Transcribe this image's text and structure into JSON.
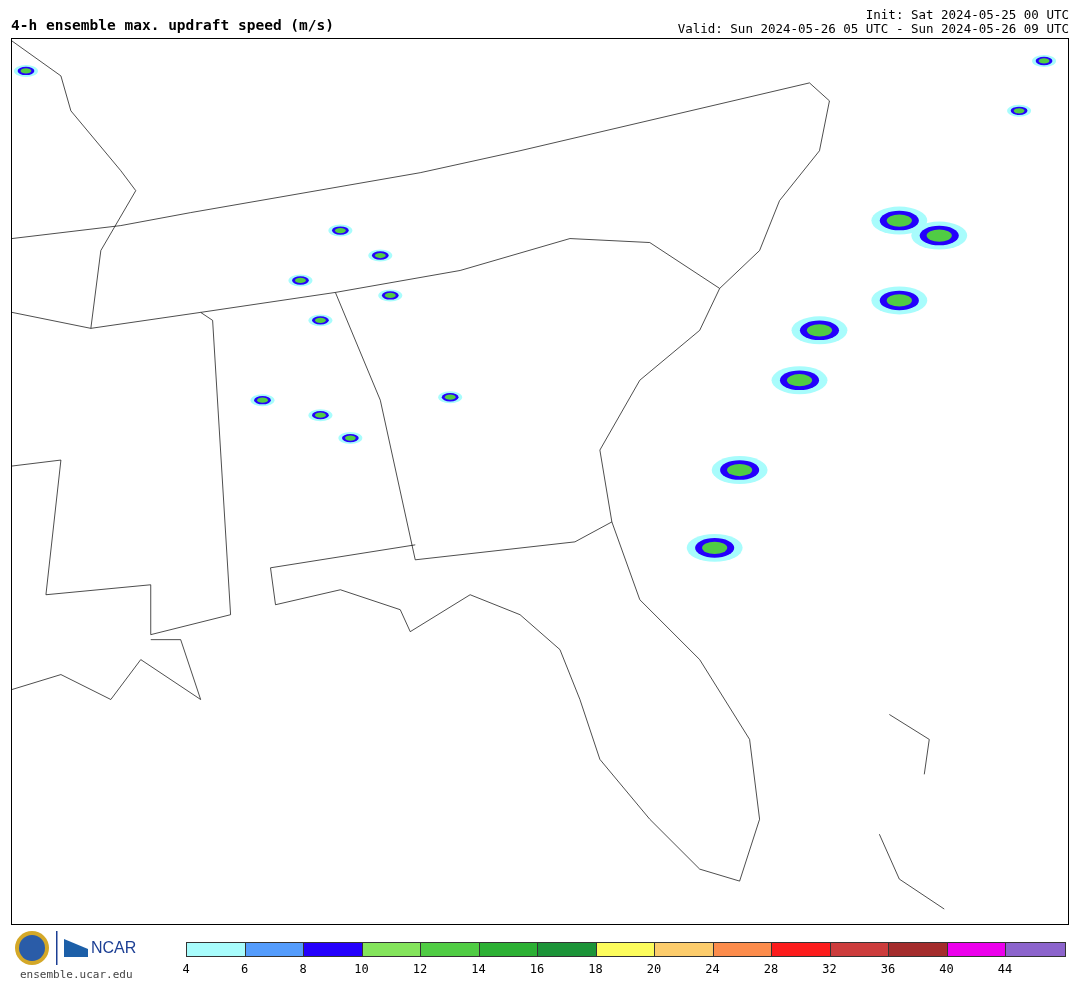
{
  "title": "4-h ensemble max. updraft speed (m/s)",
  "init": "Init: Sat 2024-05-25 00 UTC",
  "valid": "Valid: Sun 2024-05-26 05 UTC - Sun 2024-05-26 09 UTC",
  "logos": {
    "ncar": "NCAR",
    "url": "ensemble.ucar.edu"
  },
  "colorbar": [
    {
      "color": "#a8fcfc",
      "label": "4"
    },
    {
      "color": "#549cfc",
      "label": "6"
    },
    {
      "color": "#2400fc",
      "label": "8"
    },
    {
      "color": "#84e45c",
      "label": "10"
    },
    {
      "color": "#50cc44",
      "label": "12"
    },
    {
      "color": "#2cb034",
      "label": "14"
    },
    {
      "color": "#1c9438",
      "label": "16"
    },
    {
      "color": "#fcfc5c",
      "label": "18"
    },
    {
      "color": "#fccc6c",
      "label": "20"
    },
    {
      "color": "#fc8c4c",
      "label": "24"
    },
    {
      "color": "#fc1c1c",
      "label": "28"
    },
    {
      "color": "#cc3c3c",
      "label": "32"
    },
    {
      "color": "#a42c2c",
      "label": "36"
    },
    {
      "color": "#ec00ec",
      "label": "40"
    },
    {
      "color": "#8c64cc",
      "label": "44"
    }
  ]
}
